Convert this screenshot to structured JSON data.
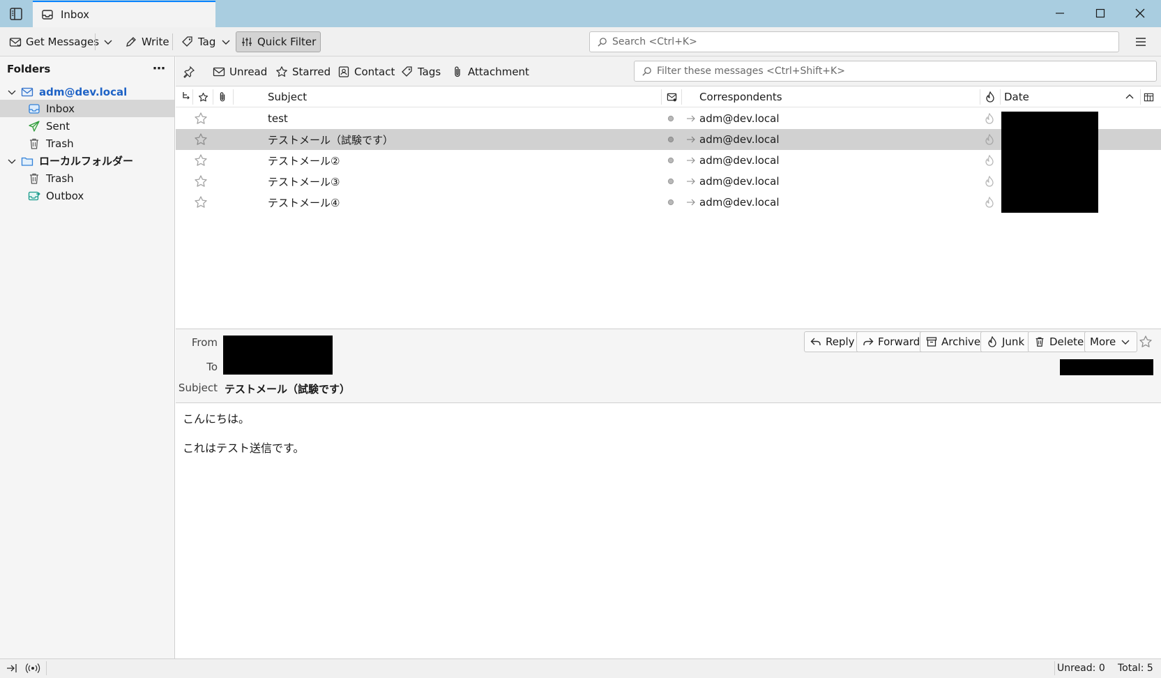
{
  "tab": {
    "title": "Inbox"
  },
  "toolbar": {
    "get_messages": "Get Messages",
    "write": "Write",
    "tag": "Tag",
    "quick_filter": "Quick Filter",
    "search_placeholder": "Search <Ctrl+K>"
  },
  "folders": {
    "header": "Folders",
    "account": "adm@dev.local",
    "inbox": "Inbox",
    "sent": "Sent",
    "trash": "Trash",
    "local_folders": "ローカルフォルダー",
    "local_trash": "Trash",
    "outbox": "Outbox"
  },
  "quickfilter": {
    "unread": "Unread",
    "starred": "Starred",
    "contact": "Contact",
    "tags": "Tags",
    "attachment": "Attachment",
    "filter_placeholder": "Filter these messages <Ctrl+Shift+K>"
  },
  "columns": {
    "subject": "Subject",
    "correspondents": "Correspondents",
    "date": "Date"
  },
  "messages": [
    {
      "subject": "test",
      "correspondent": "adm@dev.local"
    },
    {
      "subject": "テストメール（試験です）",
      "correspondent": "adm@dev.local"
    },
    {
      "subject": "テストメール②",
      "correspondent": "adm@dev.local"
    },
    {
      "subject": "テストメール③",
      "correspondent": "adm@dev.local"
    },
    {
      "subject": "テストメール④",
      "correspondent": "adm@dev.local"
    }
  ],
  "message": {
    "from_label": "From",
    "to_label": "To",
    "subject_label": "Subject",
    "subject": "テストメール（試験です）",
    "body": [
      "こんにちは。",
      "これはテスト送信です。"
    ]
  },
  "actions": {
    "reply": "Reply",
    "forward": "Forward",
    "archive": "Archive",
    "junk": "Junk",
    "delete": "Delete",
    "more": "More"
  },
  "status": {
    "unread": "Unread: 0",
    "total": "Total: 5"
  }
}
